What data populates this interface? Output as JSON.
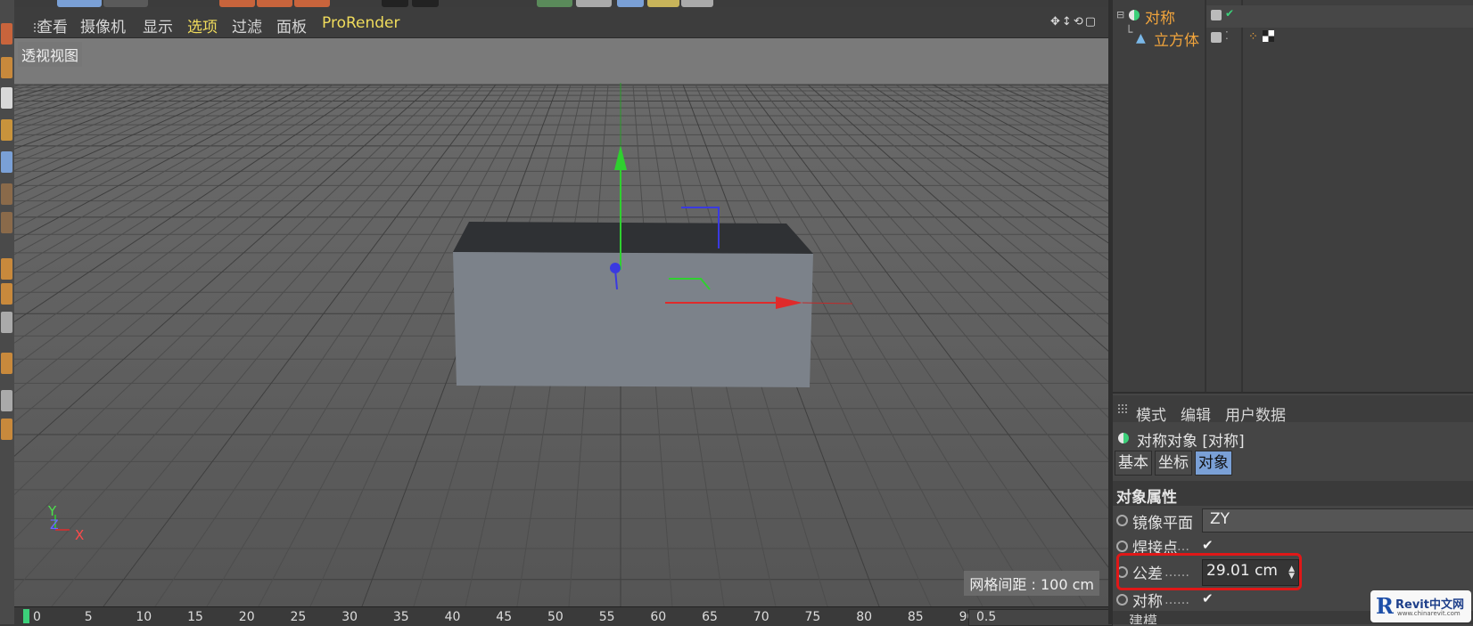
{
  "viewport": {
    "menu": [
      "查看",
      "摄像机",
      "显示",
      "选项",
      "过滤",
      "面板",
      "ProRender"
    ],
    "active_menu_index": 3,
    "view_label": "透视视图",
    "grid_info": "网格间距 : 100 cm",
    "axis_y": "Y",
    "axis_z": "Z",
    "axis_x": "X"
  },
  "timeline": {
    "ticks": [
      "0",
      "5",
      "10",
      "15",
      "20",
      "25",
      "30",
      "35",
      "40",
      "45",
      "50",
      "55",
      "60",
      "65",
      "70",
      "75",
      "80",
      "85",
      "90"
    ],
    "field_value": "0.5"
  },
  "object_manager": {
    "objects": [
      {
        "name": "对称",
        "icon": "symmetry-icon"
      },
      {
        "name": "立方体",
        "icon": "cube-icon"
      }
    ]
  },
  "attribute_manager": {
    "menu": [
      "模式",
      "编辑",
      "用户数据"
    ],
    "title": "对称对象 [对称]",
    "tabs": [
      "基本",
      "坐标",
      "对象"
    ],
    "active_tab_index": 2,
    "section": "对象属性",
    "properties": {
      "mirror_plane": {
        "label": "镜像平面",
        "value": "ZY"
      },
      "weld_points": {
        "label": "焊接点",
        "dots": "……",
        "checked": true
      },
      "tolerance": {
        "label": "公差",
        "dots": "……",
        "value": "29.01 cm"
      },
      "symmetry": {
        "label": "对称",
        "dots": "……",
        "checked": true
      },
      "next_label": "建模"
    }
  },
  "watermark": {
    "brand": "Revit中文网",
    "url": "www.chinarevit.com"
  },
  "colors": {
    "accent": "#f0dc5c",
    "object_name": "#f1a43c",
    "active_tab": "#7aa0d6",
    "highlight": "#e01818"
  }
}
